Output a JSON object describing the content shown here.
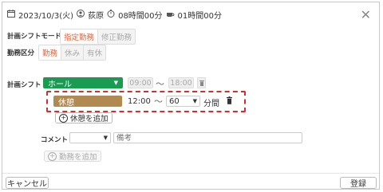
{
  "header": {
    "date": "2023/10/3(火)",
    "person": "荻原",
    "work_hours": "08時間00分",
    "break_hours": "01時間00分"
  },
  "plan_mode": {
    "label": "計画シフトモード",
    "options": [
      "指定勤務",
      "修正勤務"
    ],
    "selected": "指定勤務"
  },
  "work_type": {
    "label": "勤務区分",
    "options": [
      "勤務",
      "休み",
      "有休"
    ],
    "selected": "勤務"
  },
  "plan_shift": {
    "label": "計画シフト",
    "location": "ホール",
    "start": "09:00",
    "tilde": "〜",
    "end": "18:00"
  },
  "break_row": {
    "type": "休憩",
    "start": "12:00",
    "tilde": "〜",
    "minutes": "60",
    "unit": "分間"
  },
  "add_break_label": "休憩を追加",
  "comment": {
    "label": "コメント",
    "select_value": "",
    "placeholder": "備考"
  },
  "add_work_label": "勤務を追加",
  "footer": {
    "cancel": "キャンセル",
    "register": "登録"
  },
  "colors": {
    "accent": "#e0643c",
    "location_green": "#1a9b52",
    "break_brown": "#b08a50",
    "highlight_red": "#d62d2d"
  }
}
